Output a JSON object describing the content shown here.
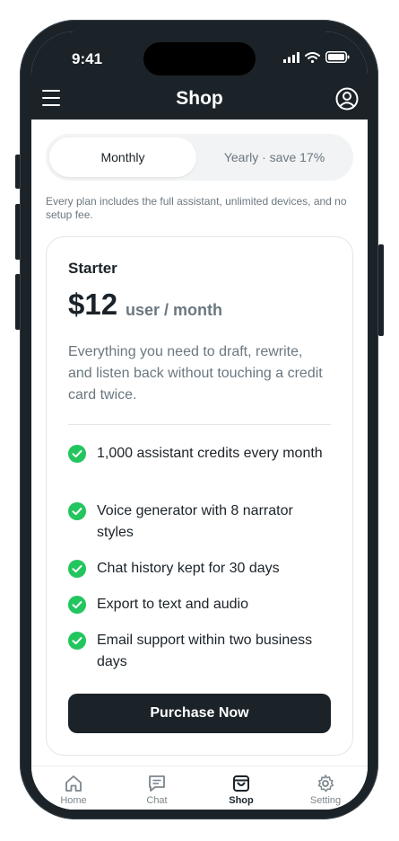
{
  "status_bar": {
    "time": "9:41"
  },
  "header": {
    "title": "Shop"
  },
  "billing_toggle": {
    "monthly": "Monthly",
    "yearly": "Yearly · save 17%"
  },
  "note": "Every plan includes the full assistant, unlimited devices, and no setup fee.",
  "plan": {
    "name": "Starter",
    "price": "$12",
    "unit": "user / month",
    "description": "Everything you need to draft, rewrite, and listen back without touching a credit card twice.",
    "features": [
      "1,000 assistant credits every month",
      "Voice generator with 8 narrator styles",
      "Chat history kept for 30 days",
      "Export to text and audio",
      "Email support within two business days"
    ],
    "purchase_label": "Purchase Now"
  },
  "nav": {
    "home": "Home",
    "chat": "Chat",
    "shop": "Shop",
    "setting": "Setting"
  },
  "colors": {
    "dark": "#1b2329",
    "check": "#22c55e",
    "muted": "#6b7780"
  },
  "icons": [
    "signal-icon",
    "wifi-icon",
    "battery-icon",
    "hamburger-menu-icon",
    "user-circle-icon",
    "check-circle-icon",
    "home-icon",
    "chat-icon",
    "shopping-bag-icon",
    "gear-icon"
  ]
}
